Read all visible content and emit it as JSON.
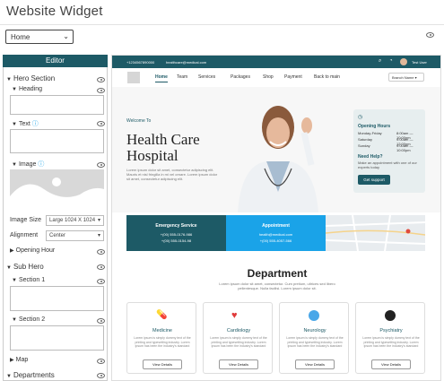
{
  "header": {
    "title": "Website Widget",
    "page_select": "Home"
  },
  "editor": {
    "title": "Editor",
    "hero": "Hero Section",
    "heading": "Heading",
    "text": "Text",
    "image": "Image",
    "image_size_label": "Image Size",
    "image_size_value": "Large 1024 X 1024",
    "alignment_label": "Alignment",
    "alignment_value": "Center",
    "opening": "Opening Hour",
    "subhero": "Sub Hero",
    "section1": "Section 1",
    "section2": "Section 2",
    "map": "Map",
    "departments": "Departments"
  },
  "preview": {
    "phone": "+1234567890000",
    "email": "healthcare@medical.com",
    "user": "Test User",
    "nav": [
      "Home",
      "Team",
      "Services",
      "Packages",
      "Shop",
      "Payment",
      "Back to main"
    ],
    "branch": "Branch Name",
    "welcome": "Welcome To",
    "hero_title": "Health Care Hospital",
    "hero_text": "Lorem ipsum dolor sit amet, consectetur adipiscing elit. Mauris et nisl fringilla in mi vel ornare. Lorem ipsum dolor sit amet, consectetur adipiscing elit.",
    "opening_title": "Opening Hours",
    "hours": [
      {
        "day": "Monday-Friday",
        "time": "8:00am — 10:00pm"
      },
      {
        "day": "Saturday",
        "time": "9:00am — 12:00pm"
      },
      {
        "day": "Sunday",
        "time": "9:00am — 10:00pm"
      }
    ],
    "help_title": "Need Help?",
    "help_text": "Make an appointment with one of our experts today",
    "support_btn": "Get support",
    "emergency_title": "Emergency Service",
    "emergency_lines": [
      "+(00) 555-0176-986",
      "+(00) 555-0154-98"
    ],
    "appointment_title": "Appointment",
    "appointment_lines": [
      "health@medical.com",
      "+(00) 555-4057-566"
    ],
    "department_title": "Department",
    "department_text": "Lorem ipsum dolor sit amet, consectetur. Cum pretium, ultrices sed libero pellentesque. Nulla facilisi. Lorem ipsum dolor sit.",
    "cards": [
      {
        "name": "Medicine",
        "text": "Lorem ipsum is simply dummy text of the printing and typesetting industry. Lorem ipsum has been the industry's standard",
        "btn": "View Details"
      },
      {
        "name": "Cardiology",
        "text": "Lorem ipsum is simply dummy text of the printing and typesetting industry. Lorem ipsum has been the industry's standard",
        "btn": "View Details"
      },
      {
        "name": "Neurology",
        "text": "Lorem ipsum is simply dummy text of the printing and typesetting industry. Lorem ipsum has been the industry's standard",
        "btn": "View Details"
      },
      {
        "name": "Psychiatry",
        "text": "Lorem ipsum is simply dummy text of the printing and typesetting industry. Lorem ipsum has been the industry's standard",
        "btn": "View Details"
      }
    ]
  },
  "colors": {
    "accent": "#1d5a66",
    "appointment": "#1aa3e8"
  }
}
